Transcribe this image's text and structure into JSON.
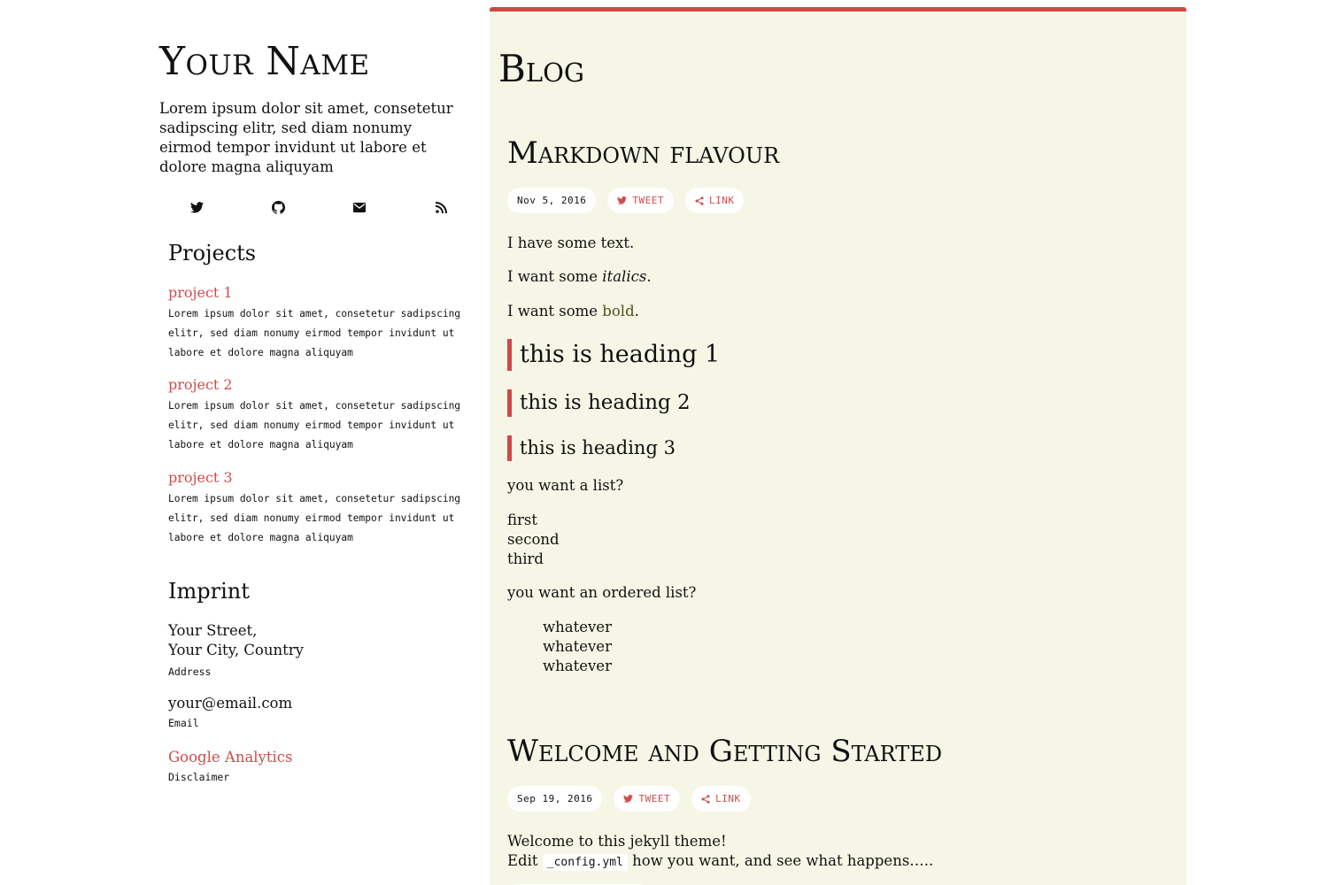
{
  "sidebar": {
    "name": "Your Name",
    "description": "Lorem ipsum dolor sit amet, consetetur sadipscing elitr, sed diam nonumy eirmod tempor invidunt ut labore et dolore magna aliquyam",
    "social": [
      "twitter-icon",
      "github-icon",
      "mail-icon",
      "rss-icon"
    ],
    "projects_title": "Projects",
    "projects": [
      {
        "name": "project 1",
        "desc": "Lorem ipsum dolor sit amet, consetetur sadipscing elitr, sed diam nonumy eirmod tempor invidunt ut labore et dolore magna aliquyam"
      },
      {
        "name": "project 2",
        "desc": "Lorem ipsum dolor sit amet, consetetur sadipscing elitr, sed diam nonumy eirmod tempor invidunt ut labore et dolore magna aliquyam"
      },
      {
        "name": "project 3",
        "desc": "Lorem ipsum dolor sit amet, consetetur sadipscing elitr, sed diam nonumy eirmod tempor invidunt ut labore et dolore magna aliquyam"
      }
    ],
    "imprint_title": "Imprint",
    "address_line1": "Your Street,",
    "address_line2": "Your City, Country",
    "address_label": "Address",
    "email": "your@email.com",
    "email_label": "Email",
    "analytics": "Google Analytics",
    "analytics_label": "Disclaimer"
  },
  "main": {
    "title": "Blog",
    "accent": "#d04848",
    "posts": [
      {
        "title": "Markdown flavour",
        "date": "Nov 5, 2016",
        "tweet": "Tweet",
        "link": "Link",
        "line1": "I have some text.",
        "line2_pre": "I want some ",
        "line2_em": "italics",
        "line2_post": ".",
        "line3_pre": "I want some ",
        "line3_bold": "bold",
        "line3_post": ".",
        "h1": "this is heading 1",
        "h2": "this is heading 2",
        "h3": "this is heading 3",
        "list_intro": "you want a list?",
        "list": [
          "first",
          "second",
          "third"
        ],
        "olist_intro": "you want an ordered list?",
        "olist": [
          "whatever",
          "whatever",
          "whatever"
        ]
      },
      {
        "title": "Welcome and Getting Started",
        "date": "Sep 19, 2016",
        "tweet": "Tweet",
        "link": "Link",
        "line1": "Welcome to this jekyll theme!",
        "line2_pre": "Edit",
        "line2_code": "_config.yml",
        "line2_post": "how you want, and see what happens….."
      }
    ]
  }
}
